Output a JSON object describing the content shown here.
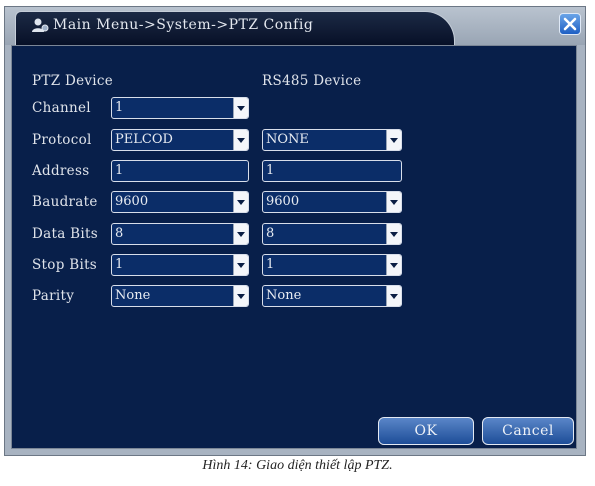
{
  "window": {
    "title": "Main Menu->System->PTZ Config"
  },
  "sections": {
    "ptz_device": "PTZ Device",
    "rs485_device": "RS485 Device"
  },
  "rows": {
    "channel": {
      "label": "Channel",
      "ptz": "1"
    },
    "protocol": {
      "label": "Protocol",
      "ptz": "PELCOD",
      "rs485": "NONE"
    },
    "address": {
      "label": "Address",
      "ptz": "1",
      "rs485": "1"
    },
    "baudrate": {
      "label": "Baudrate",
      "ptz": "9600",
      "rs485": "9600"
    },
    "data_bits": {
      "label": "Data Bits",
      "ptz": "8",
      "rs485": "8"
    },
    "stop_bits": {
      "label": "Stop Bits",
      "ptz": "1",
      "rs485": "1"
    },
    "parity": {
      "label": "Parity",
      "ptz": "None",
      "rs485": "None"
    }
  },
  "buttons": {
    "ok": "OK",
    "cancel": "Cancel"
  },
  "caption": "Hình 14: Giao diện thiết lập PTZ.",
  "icons": {
    "title": "user-gear-icon",
    "close": "close-icon",
    "dropdown": "chevron-down-icon"
  },
  "colors": {
    "panel_bg": "#081f4a",
    "title_bg": "#071027",
    "accent": "#1e5fc4"
  }
}
